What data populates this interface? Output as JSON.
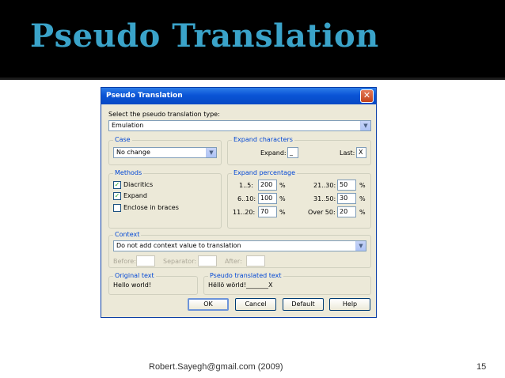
{
  "slide": {
    "title": "Pseudo Translation",
    "footer": "Robert.Sayegh@gmail.com (2009)",
    "page_number": "15"
  },
  "dialog": {
    "title": "Pseudo Translation",
    "type_label": "Select the pseudo translation type:",
    "type_value": "Emulation",
    "case": {
      "title": "Case",
      "value": "No change"
    },
    "expand_characters": {
      "title": "Expand characters",
      "expand_label": "Expand:",
      "expand_value": "_",
      "last_label": "Last:",
      "last_value": "X"
    },
    "methods": {
      "title": "Methods",
      "items": [
        {
          "label": "Diacritics",
          "checked": true
        },
        {
          "label": "Expand",
          "checked": true
        },
        {
          "label": "Enclose in braces",
          "checked": false
        }
      ]
    },
    "expand_percentage": {
      "title": "Expand percentage",
      "rows": [
        {
          "left_label": "1..5:",
          "left_value": "200",
          "right_label": "21..30:",
          "right_value": "50"
        },
        {
          "left_label": "6..10:",
          "left_value": "100",
          "right_label": "31..50:",
          "right_value": "30"
        },
        {
          "left_label": "11..20:",
          "left_value": "70",
          "right_label": "Over 50:",
          "right_value": "20"
        }
      ],
      "unit": "%"
    },
    "context": {
      "title": "Context",
      "value": "Do not add context value to translation",
      "before_label": "Before:",
      "separator_label": "Separator:",
      "after_label": "After:"
    },
    "original": {
      "title": "Original text",
      "value": "Hello world!"
    },
    "pseudo": {
      "title": "Pseudo translated text",
      "value": "Hëllö wörld!_______X"
    },
    "buttons": {
      "ok": "OK",
      "cancel": "Cancel",
      "default": "Default",
      "help": "Help"
    },
    "colors": {
      "title_bar": "#0a54d6",
      "group_title": "#0046d5",
      "slide_title": "#3aa3c9"
    }
  }
}
